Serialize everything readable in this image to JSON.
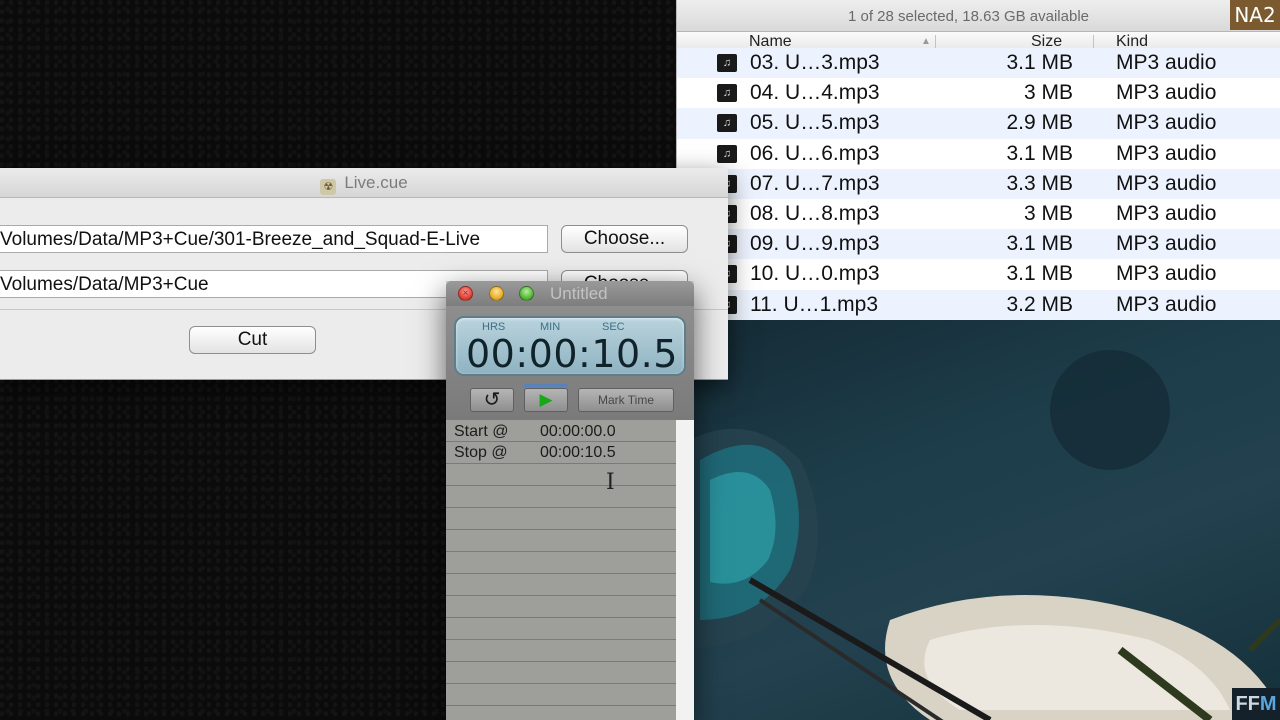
{
  "finder": {
    "status": "1 of 28 selected, 18.63 GB available",
    "columns": {
      "name": "Name",
      "size": "Size",
      "kind": "Kind"
    },
    "files": [
      {
        "name": "03. U…3.mp3",
        "size": "3.1 MB",
        "kind": "MP3 audio"
      },
      {
        "name": "04. U…4.mp3",
        "size": "3 MB",
        "kind": "MP3 audio"
      },
      {
        "name": "05. U…5.mp3",
        "size": "2.9 MB",
        "kind": "MP3 audio"
      },
      {
        "name": "06. U…6.mp3",
        "size": "3.1 MB",
        "kind": "MP3 audio"
      },
      {
        "name": "07. U…7.mp3",
        "size": "3.3 MB",
        "kind": "MP3 audio"
      },
      {
        "name": "08. U…8.mp3",
        "size": "3 MB",
        "kind": "MP3 audio"
      },
      {
        "name": "09. U…9.mp3",
        "size": "3.1 MB",
        "kind": "MP3 audio"
      },
      {
        "name": "10. U…0.mp3",
        "size": "3.1 MB",
        "kind": "MP3 audio"
      },
      {
        "name": "11. U…1.mp3",
        "size": "3.2 MB",
        "kind": "MP3 audio"
      }
    ]
  },
  "cue_window": {
    "title": "Live.cue",
    "source_path": "Volumes/Data/MP3+Cue/301-Breeze_and_Squad-E-Live",
    "dest_path": "Volumes/Data/MP3+Cue",
    "choose_label": "Choose...",
    "cut_label": "Cut"
  },
  "timer_window": {
    "title": "Untitled",
    "lcd_labels": {
      "hrs": "HRS",
      "min": "MIN",
      "sec": "SEC"
    },
    "time": "00:00:10.5",
    "reset_glyph": "↺",
    "play_glyph": "▶",
    "mark_time_label": "Mark Time",
    "log": [
      {
        "label": "Start @",
        "value": "00:00:00.0"
      },
      {
        "label": "Stop @",
        "value": "00:00:10.5"
      }
    ]
  },
  "watermarks": {
    "top_right": "NA2",
    "bottom_right_prefix": "FF",
    "bottom_right_suffix": "M"
  },
  "colors": {
    "row_alt": "#edf3fe",
    "lcd": "#a9c7d3",
    "play_green": "#18a818"
  }
}
